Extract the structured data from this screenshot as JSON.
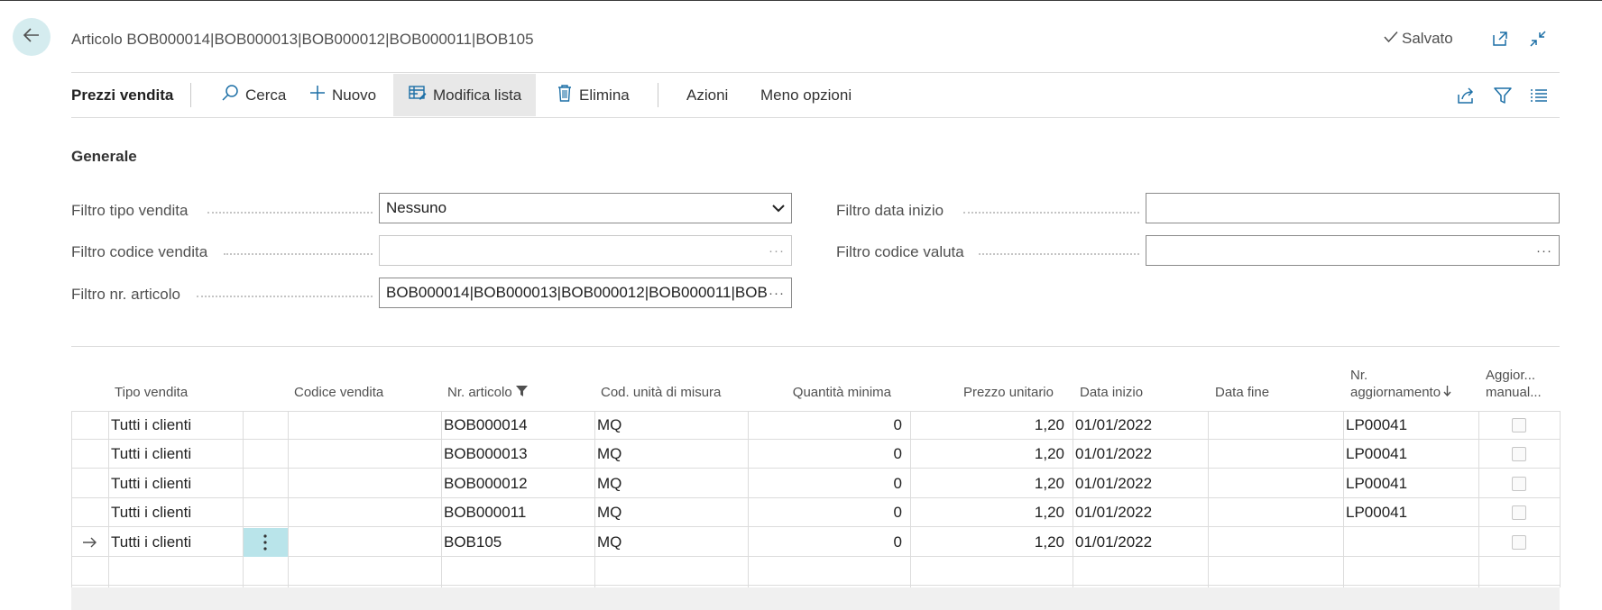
{
  "header": {
    "title": "Articolo BOB000014|BOB000013|BOB000012|BOB000011|BOB105",
    "saved_label": "Salvato"
  },
  "actionbar": {
    "page_name": "Prezzi vendita",
    "search": "Cerca",
    "new": "Nuovo",
    "edit_list": "Modifica lista",
    "delete": "Elimina",
    "actions": "Azioni",
    "fewer_options": "Meno opzioni"
  },
  "general": {
    "title": "Generale",
    "sales_type_filter_label": "Filtro tipo vendita",
    "sales_type_filter_value": "Nessuno",
    "sales_code_filter_label": "Filtro codice vendita",
    "sales_code_filter_value": "",
    "item_no_filter_label": "Filtro nr. articolo",
    "item_no_filter_value": "BOB000014|BOB000013|BOB000012|BOB000011|BOB",
    "start_date_filter_label": "Filtro data inizio",
    "start_date_filter_value": "",
    "currency_filter_label": "Filtro codice valuta",
    "currency_filter_value": ""
  },
  "table": {
    "columns": {
      "sales_type": "Tipo vendita",
      "sales_code": "Codice vendita",
      "item_no": "Nr. articolo",
      "uom": "Cod. unità di misura",
      "min_qty": "Quantità minima",
      "unit_price": "Prezzo unitario",
      "start_date": "Data inizio",
      "end_date": "Data fine",
      "update_no_1": "Nr.",
      "update_no_2": "aggiornamento",
      "manual_1": "Aggior...",
      "manual_2": "manual..."
    },
    "rows": [
      {
        "sales_type": "Tutti i clienti",
        "item_no": "BOB000014",
        "uom": "MQ",
        "min_qty": "0",
        "unit_price": "1,20",
        "start_date": "01/01/2022",
        "update_no": "LP00041",
        "manual": false
      },
      {
        "sales_type": "Tutti i clienti",
        "item_no": "BOB000013",
        "uom": "MQ",
        "min_qty": "0",
        "unit_price": "1,20",
        "start_date": "01/01/2022",
        "update_no": "LP00041",
        "manual": false
      },
      {
        "sales_type": "Tutti i clienti",
        "item_no": "BOB000012",
        "uom": "MQ",
        "min_qty": "0",
        "unit_price": "1,20",
        "start_date": "01/01/2022",
        "update_no": "LP00041",
        "manual": false
      },
      {
        "sales_type": "Tutti i clienti",
        "item_no": "BOB000011",
        "uom": "MQ",
        "min_qty": "0",
        "unit_price": "1,20",
        "start_date": "01/01/2022",
        "update_no": "LP00041",
        "manual": false
      },
      {
        "sales_type": "Tutti i clienti",
        "item_no": "BOB105",
        "uom": "MQ",
        "min_qty": "0",
        "unit_price": "1,20",
        "start_date": "01/01/2022",
        "update_no": "",
        "manual": false
      }
    ]
  },
  "colors": {
    "accent": "#d5ecef",
    "row_menu": "#b9e4ea",
    "icon_blue": "#1c6fa6"
  },
  "icons": [
    "back-arrow-icon",
    "checkmark-icon",
    "popout-icon",
    "collapse-icon",
    "search-icon",
    "plus-icon",
    "edit-list-icon",
    "trash-icon",
    "share-icon",
    "filter-icon",
    "list-icon",
    "chevron-down-icon",
    "ellipsis-icon",
    "sort-desc-icon",
    "row-arrow-icon",
    "row-menu-icon"
  ]
}
